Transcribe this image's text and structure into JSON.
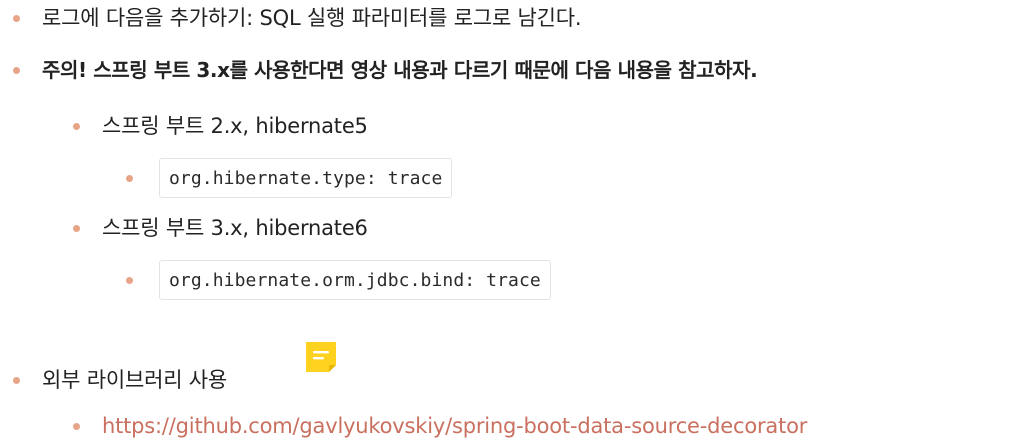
{
  "items": {
    "log_params": "로그에 다음을 추가하기: SQL 실행 파라미터를 로그로 남긴다.",
    "warning": "주의! 스프링 부트 3.x를 사용한다면 영상 내용과 다르기 때문에 다음 내용을 참고하자.",
    "boot2": "스프링 부트 2.x, hibernate5",
    "boot2_config": "org.hibernate.type: trace",
    "boot3": "스프링 부트 3.x, hibernate6",
    "boot3_config": "org.hibernate.orm.jdbc.bind: trace",
    "external_lib": "외부 라이브러리 사용",
    "external_link": "https://github.com/gavlyukovskiy/spring-boot-data-source-decorator"
  },
  "icons": {
    "memo": "memo-icon"
  },
  "colors": {
    "bullet": "#e8a487",
    "link": "#c9705f",
    "memo_icon": "#ffd21f"
  }
}
